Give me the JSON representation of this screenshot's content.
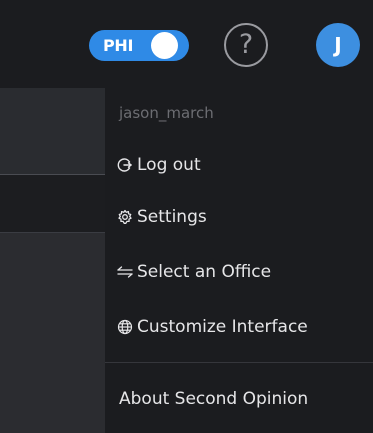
{
  "header": {
    "phi_toggle": {
      "label": "PHI",
      "state": "on",
      "accent": "#2f8ae6"
    },
    "help": {
      "glyph": "?",
      "icon": "help-circle-icon"
    },
    "avatar": {
      "initial": "J",
      "color": "#3d8fe0"
    }
  },
  "menu": {
    "username": "jason_march",
    "items": [
      {
        "label": "Log out",
        "icon": "logout-icon"
      },
      {
        "label": "Settings",
        "icon": "gear-icon"
      },
      {
        "label": "Select an Office",
        "icon": "swap-arrows-icon"
      },
      {
        "label": "Customize Interface",
        "icon": "globe-icon"
      },
      {
        "label": "About Second Opinion",
        "icon": ""
      }
    ]
  }
}
